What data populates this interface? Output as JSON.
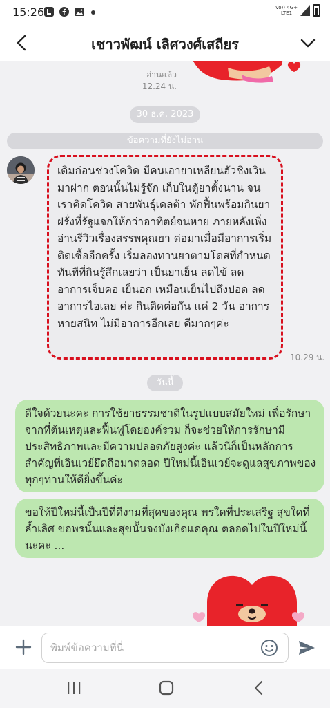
{
  "status_bar": {
    "time": "15:26",
    "network": "Vo)) 4G+\nLTE1",
    "icons": [
      "line-icon",
      "facebook-icon",
      "gallery-icon",
      "dot-icon",
      "signal-icon",
      "battery-icon"
    ]
  },
  "header": {
    "title": "เชาวพัฒน์ เลิศวงศ์เสถียร",
    "back_icon": "chevron-left-icon",
    "menu_icon": "chevron-down-icon"
  },
  "chat": {
    "read_label": "อ่านแล้ว",
    "read_time": "12.24 น.",
    "date_label": "30 ธ.ค. 2023",
    "unread_label": "ข้อความที่ยังไม่อ่าน",
    "incoming_message": "เดิมก่อนช่วงโควิด มีคนเอายาเหลียนฮัวชิงเวิน มาฝาก ตอนนั้นไม่รู้จัก เก็บในตู้ยาตั้งนาน จนเราคิดโควิด สายพันธุ์เดลต้า พักฟื้นพร้อมกินยาฝรั่งที่รัฐแจกให้กว่าอาทิตย์จนหาย ภายหลังเพิ่งอ่านรีวิวเรื่องสรรพคุณยา ต่อมาเมื่อมีอาการเริ่มติดเชื้ออีกครั้ง เริ่มลองทานยาตามโดสที่กำหนด ทันทีที่กินรู้สึกเลยว่า เป็นยาเย็น ลดไข้ ลดอาการเจ็บคอ เย็นอก เหมือนเย็นไปถึงปอด ลดอาการไอเลย ค่ะ กินติดต่อกัน แค่ 2 วัน อาการหายสนิท ไม่มีอาการอีกเลย  ดีมากๆค่ะ",
    "incoming_time": "10.29 น.",
    "today_label": "วันนี้",
    "outgoing_messages": [
      "ดีใจด้วยนะคะ การใช้ยาธรรมชาติในรูปแบบสมัยใหม่ เพื่อรักษาจากที่ต้นเหตุและฟื้นฟูโดยองค์รวม ก็จะช่วยให้การรักษามีประสิทธิภาพและมีความปลอดภัยสูงค่ะ แล้วนี่ก็เป็นหลักการสำคัญที่เอินเวย์ยึดถือมาตลอด ปีใหม่นี้เอินเวย์จะดูแลสุขภาพของทุกๆท่านให้ดียิ่งขึ้นค่ะ",
      "ขอให้ปีใหม่นี้เป็นปีที่ดีงามที่สุดของคุณ พรใดที่ประเสริฐ สุขใดที่ล้ำเลิศ ขอพรนั้นและสุขนั้นจงบังเกิดแด่คุณ ตลอดไปในปีใหม่นี้นะคะ ..."
    ]
  },
  "input": {
    "placeholder": "พิมพ์ข้อความที่นี่",
    "plus_icon": "plus-icon",
    "emoji_icon": "emoji-icon",
    "send_icon": "send-icon"
  },
  "nav": {
    "icons": [
      "recent-apps-icon",
      "home-icon",
      "back-icon"
    ]
  },
  "colors": {
    "outgoing_bubble": "#bde7b0",
    "incoming_bubble": "#ececee",
    "highlight_border": "#d8101e",
    "chat_background": "#f1f1f3",
    "sticker_red": "#e8232a"
  }
}
